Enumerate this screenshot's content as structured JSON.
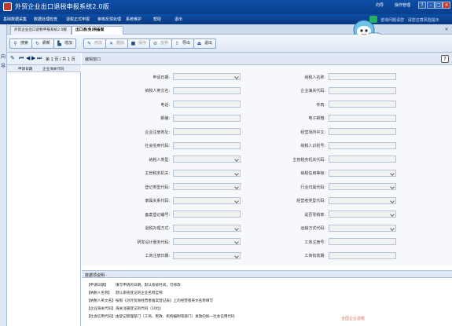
{
  "app": {
    "title": "外贸企业出口退税申报系统2.0版",
    "top_right": [
      "向导",
      "操作管理",
      "?",
      "-",
      "□",
      "×"
    ]
  },
  "menu": {
    "items": [
      "基础数据采集",
      "数据处理检查",
      "退税正式申报",
      "审核反馈处理",
      "系统维护",
      "帮助",
      "退出"
    ],
    "cs_text": "咨询问题请您 · 请您注意风险提示"
  },
  "side": {
    "chars": [
      "向",
      "导"
    ]
  },
  "tabs": [
    {
      "label": "外贸企业出口退税申报系统2.0版"
    },
    {
      "label": "出口退(免)税备案",
      "active": true
    }
  ],
  "mascot": {
    "bubble": "在线客服"
  },
  "toolbar": {
    "buttons": [
      {
        "label": "搜索",
        "icon": "search-icon"
      },
      {
        "label": "刷新",
        "icon": "refresh-icon"
      },
      {
        "label": "增加",
        "icon": "add-icon"
      },
      {
        "label": "修改",
        "icon": "edit-icon",
        "disabled": true
      },
      {
        "label": "删除",
        "icon": "delete-icon",
        "disabled": true
      },
      {
        "label": "保存",
        "icon": "save-icon",
        "disabled": true
      },
      {
        "label": "放弃",
        "icon": "cancel-icon",
        "disabled": true
      },
      {
        "label": "导出",
        "icon": "export-icon"
      },
      {
        "label": "退出",
        "icon": "exit-icon"
      }
    ]
  },
  "pager": {
    "text": "第 1 页 / 共 1 页"
  },
  "grid": {
    "columns": [
      "申请日期",
      "企业海关代码"
    ]
  },
  "edit": {
    "header": "编辑窗口",
    "help": "?"
  },
  "form": {
    "left": [
      {
        "label": "申请日期:",
        "select": true
      },
      {
        "label": "纳税人英文名:"
      },
      {
        "label": "电话:"
      },
      {
        "label": "邮编:"
      },
      {
        "label": "企业注册地址:"
      },
      {
        "label": "社会信用代码:"
      },
      {
        "label": "纳税人类型:",
        "select": true
      },
      {
        "label": "主管税务机关:",
        "select": true
      },
      {
        "label": "登记类型代码:",
        "select": true
      },
      {
        "label": "隶属关系代码:",
        "select": true
      },
      {
        "label": "备案登记编号:"
      },
      {
        "label": "退税办理方式:",
        "select": true
      },
      {
        "label": "研发设计服务代码:",
        "select": true
      },
      {
        "label": "工商注册日期:",
        "select": true
      }
    ],
    "right": [
      {
        "label": "纳税人名称:"
      },
      {
        "label": "企业海关代码:"
      },
      {
        "label": "传真:"
      },
      {
        "label": "电子邮箱:"
      },
      {
        "label": "经营场所中文:"
      },
      {
        "label": "纳税人识别号:"
      },
      {
        "label": "主管税务机关代码:"
      },
      {
        "label": "纳税信用等级:",
        "select": true
      },
      {
        "label": "行业归属代码:",
        "select": true
      },
      {
        "label": "经营者类型代码:",
        "select": true
      },
      {
        "label": "是否零税率:",
        "select": true
      },
      {
        "label": "运输方式代码:",
        "select": true
      },
      {
        "label": "工商注册号:"
      },
      {
        "label": "工商有效期:"
      }
    ]
  },
  "description": {
    "title": "数据项说明 ·",
    "rows": [
      {
        "key": "【申请日期】",
        "text": "填写申请的日期，默认系统时间，可修改"
      },
      {
        "key": "【纳税人名称】",
        "text": "默认系统登记的企业名称全称"
      },
      {
        "key": "【纳税人英文名】",
        "text": "按照《对外贸易经营者备案登记表》上的经营者英文名称填写"
      },
      {
        "key": "【企业海关代码】",
        "text": "海关注册登记的代码（10位）"
      },
      {
        "key": "【社会信用代码】",
        "text": "由登记管理部门（工商、民政、机构编制等部门）发放的统一社会信用代码"
      }
    ]
  },
  "watermark": "全国企业退税"
}
